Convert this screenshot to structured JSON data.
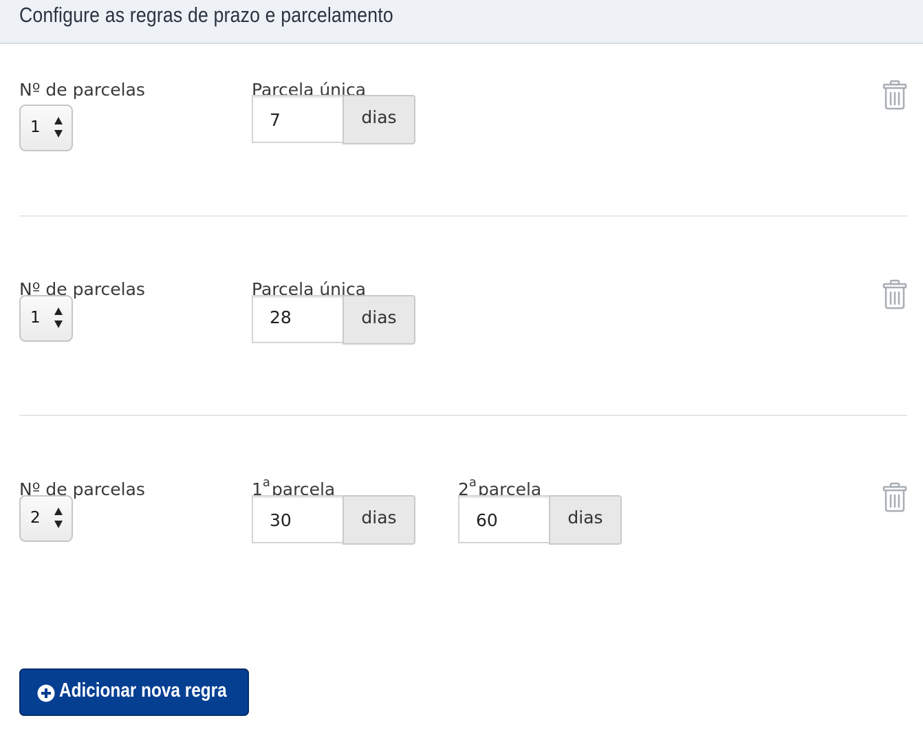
{
  "header": {
    "title": "Configure as regras de prazo e parcelamento"
  },
  "rules": [
    {
      "count_label": "Nº de parcelas",
      "count_value": "1",
      "installments": [
        {
          "label": "Parcela única",
          "ordinal": "",
          "value": "7",
          "unit": "dias"
        }
      ]
    },
    {
      "count_label": "Nº de parcelas",
      "count_value": "1",
      "installments": [
        {
          "label": "Parcela única",
          "ordinal": "",
          "value": "28",
          "unit": "dias"
        }
      ]
    },
    {
      "count_label": "Nº de parcelas",
      "count_value": "2",
      "installments": [
        {
          "ordinal": "1",
          "sup": "a",
          "label": "parcela",
          "value": "30",
          "unit": "dias"
        },
        {
          "ordinal": "2",
          "sup": "a",
          "label": "parcela",
          "value": "60",
          "unit": "dias"
        }
      ]
    }
  ],
  "add_button": {
    "icon": "plus-circle-icon",
    "label": "Adicionar nova regra"
  },
  "colors": {
    "header_bg": "#eef2f7",
    "button_bg": "#053f92",
    "addon_bg": "#e8e8e8",
    "trash_icon": "#a7adb4"
  }
}
